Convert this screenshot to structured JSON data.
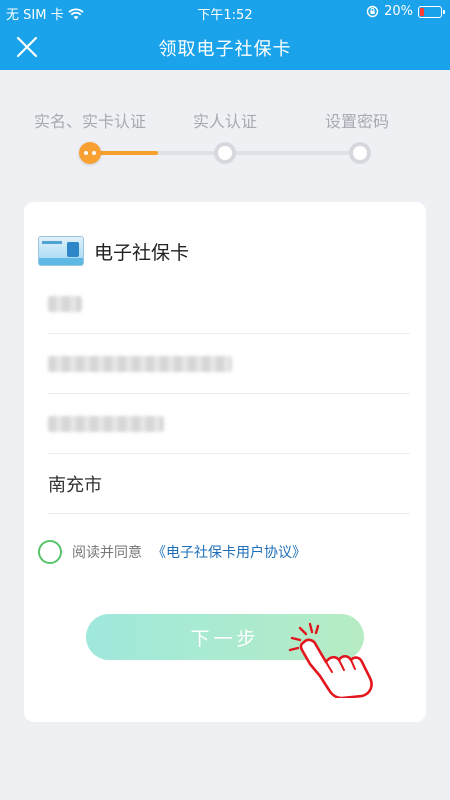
{
  "status_bar": {
    "carrier": "无 SIM 卡",
    "time": "下午1:52",
    "battery": "20%",
    "battery_level": 0.2,
    "icons": [
      "wifi-icon",
      "orientation-lock-icon",
      "battery-icon"
    ]
  },
  "nav": {
    "title": "领取电子社保卡",
    "close_icon": "close-icon"
  },
  "steps": {
    "items": [
      {
        "label": "实名、实卡认证",
        "state": "active"
      },
      {
        "label": "实人认证",
        "state": "pending"
      },
      {
        "label": "设置密码",
        "state": "pending"
      }
    ],
    "progress": 0.25,
    "colors": {
      "active": "#f8a031",
      "inactive": "#dfe1e6"
    }
  },
  "card": {
    "title": "电子社保卡",
    "icon": "social-security-card-icon",
    "fields": [
      {
        "name": "name-field",
        "value": "",
        "blurred": true
      },
      {
        "name": "id-number-field",
        "value": "",
        "blurred": true
      },
      {
        "name": "card-number-field",
        "value": "",
        "blurred": true
      },
      {
        "name": "city-field",
        "value": "南充市",
        "blurred": false
      }
    ],
    "agreement": {
      "prefix": "阅读并同意",
      "link": "《电子社保卡用户协议》",
      "checked": false
    },
    "next_button": "下一步"
  },
  "colors": {
    "primary": "#1aa3ea",
    "link": "#1e6fb9",
    "radio_border": "#58c46a",
    "button_gradient": [
      "#9fe8dc",
      "#b6ecc4"
    ],
    "hand_outline": "#e2161c"
  }
}
